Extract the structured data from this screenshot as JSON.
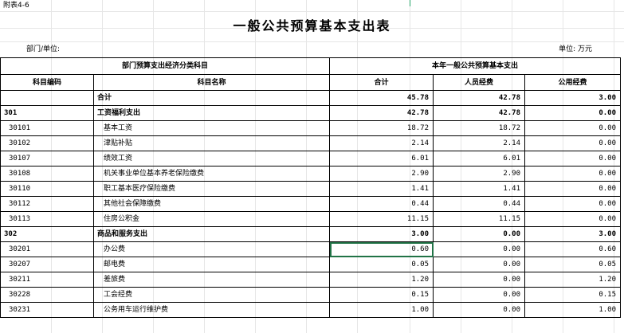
{
  "attachment": "附表4-6",
  "title": "一般公共预算基本支出表",
  "dept_label": "部门/单位:",
  "unit_label": "单位: 万元",
  "header": {
    "group_left": "部门预算支出经济分类科目",
    "group_right": "本年一般公共预算基本支出",
    "col_code": "科目编码",
    "col_name": "科目名称",
    "col_total": "合计",
    "col_personnel": "人员经费",
    "col_public": "公用经费"
  },
  "rows": [
    {
      "code": "",
      "name": "合计",
      "total": "45.78",
      "personnel": "42.78",
      "public": "3.00",
      "bold": true
    },
    {
      "code": "301",
      "name": "工资福利支出",
      "total": "42.78",
      "personnel": "42.78",
      "public": "0.00",
      "bold": true
    },
    {
      "code": "30101",
      "name": "基本工资",
      "total": "18.72",
      "personnel": "18.72",
      "public": "0.00"
    },
    {
      "code": "30102",
      "name": "津贴补贴",
      "total": "2.14",
      "personnel": "2.14",
      "public": "0.00"
    },
    {
      "code": "30107",
      "name": "绩效工资",
      "total": "6.01",
      "personnel": "6.01",
      "public": "0.00"
    },
    {
      "code": "30108",
      "name": "机关事业单位基本养老保险缴费",
      "total": "2.90",
      "personnel": "2.90",
      "public": "0.00"
    },
    {
      "code": "30110",
      "name": "职工基本医疗保险缴费",
      "total": "1.41",
      "personnel": "1.41",
      "public": "0.00"
    },
    {
      "code": "30112",
      "name": "其他社会保障缴费",
      "total": "0.44",
      "personnel": "0.44",
      "public": "0.00"
    },
    {
      "code": "30113",
      "name": "住房公积金",
      "total": "11.15",
      "personnel": "11.15",
      "public": "0.00"
    },
    {
      "code": "302",
      "name": "商品和服务支出",
      "total": "3.00",
      "personnel": "0.00",
      "public": "3.00",
      "bold": true
    },
    {
      "code": "30201",
      "name": "办公费",
      "total": "0.60",
      "personnel": "0.00",
      "public": "0.60",
      "selected": true
    },
    {
      "code": "30207",
      "name": "邮电费",
      "total": "0.05",
      "personnel": "0.00",
      "public": "0.05"
    },
    {
      "code": "30211",
      "name": "差旅费",
      "total": "1.20",
      "personnel": "0.00",
      "public": "1.20"
    },
    {
      "code": "30228",
      "name": "工会经费",
      "total": "0.15",
      "personnel": "0.00",
      "public": "0.15"
    },
    {
      "code": "30231",
      "name": "公务用车运行维护费",
      "total": "1.00",
      "personnel": "0.00",
      "public": "1.00"
    }
  ]
}
